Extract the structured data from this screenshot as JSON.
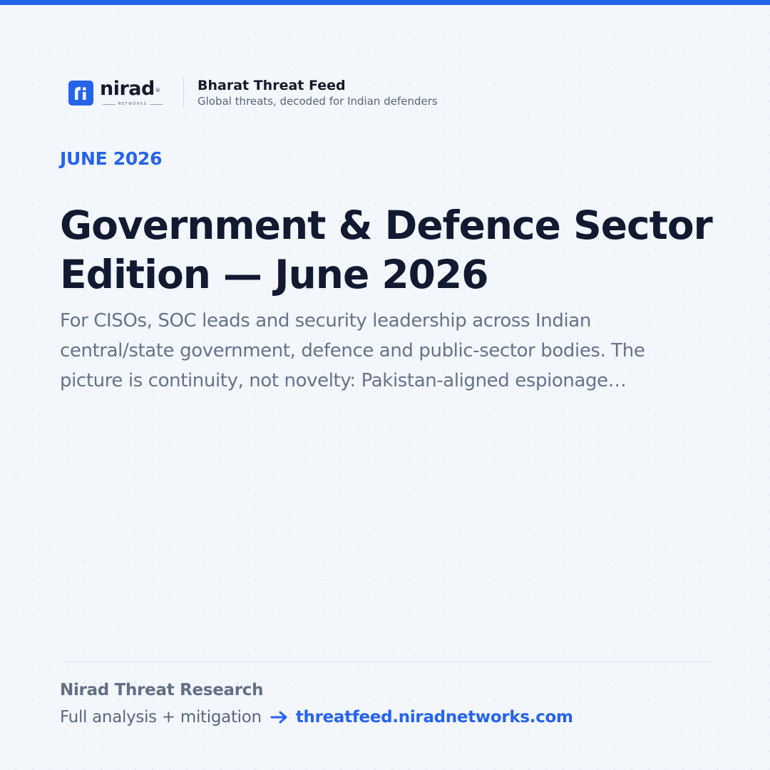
{
  "colors": {
    "accent": "#2563eb",
    "heading": "#111a30",
    "body_text": "#66738a",
    "background": "#f3f6fb"
  },
  "logo": {
    "wordmark": "nirad",
    "registered_mark": "®",
    "subtitle": "NETWORKS",
    "mark_icon": "nirad-ri-logo-icon"
  },
  "brand": {
    "title": "Bharat Threat Feed",
    "tagline": "Global threats, decoded for Indian defenders"
  },
  "edition": {
    "date_label": "JUNE 2026",
    "headline": "Government & Defence Sector Edition — June 2026",
    "summary": "For CISOs, SOC leads and security leadership across Indian central/state government, defence and public-sector bodies. The picture is continuity, not novelty: Pakistan-aligned espionage…"
  },
  "footer": {
    "author": "Nirad Threat Research",
    "cta_text": "Full analysis + mitigation",
    "cta_icon": "arrow-right-icon",
    "link_text": "threatfeed.niradnetworks.com"
  }
}
